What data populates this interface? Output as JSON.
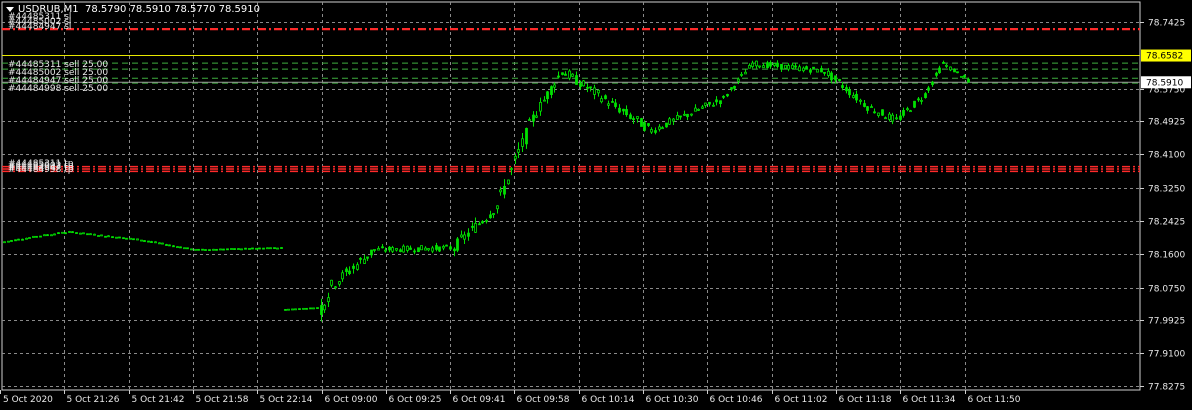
{
  "header": {
    "symbol": "USDRUB,M1",
    "ohlc": "78.5790 78.5910 78.5770 78.5910"
  },
  "colors": {
    "background": "#000000",
    "grid": "#8a8a8a",
    "candle": "#00e000",
    "text": "#ffffff",
    "sl_line": "#ff2a2a",
    "tp_line": "#d8b0b0",
    "order_line": "#3fae3f",
    "open_price_line": "#e8e800",
    "ask_label_bg": "#ffff00",
    "bid_label_bg": "#ffffff"
  },
  "price_axis": {
    "labels": [
      "78.7425",
      "78.6582",
      "78.5910",
      "78.4925",
      "78.4100",
      "78.3250",
      "78.2425",
      "78.1600",
      "78.0750",
      "77.9925",
      "77.9100",
      "77.8275"
    ],
    "ticks": [
      78.7425,
      78.575,
      78.4925,
      78.41,
      78.325,
      78.2425,
      78.16,
      78.075,
      77.9925,
      77.91,
      77.8275
    ],
    "tick_labels": [
      "78.7425",
      "78.5750",
      "78.4925",
      "78.4100",
      "78.3250",
      "78.2425",
      "78.1600",
      "78.0750",
      "77.9925",
      "77.9100",
      "77.8275"
    ],
    "ask_label": "78.6582",
    "ask_price": 78.6582,
    "bid_label": "78.5910",
    "bid_price": 78.591
  },
  "time_axis": {
    "labels": [
      "5 Oct 2020",
      "5 Oct 21:26",
      "5 Oct 21:42",
      "5 Oct 21:58",
      "5 Oct 22:14",
      "6 Oct 09:00",
      "6 Oct 09:25",
      "6 Oct 09:41",
      "6 Oct 09:58",
      "6 Oct 10:14",
      "6 Oct 10:30",
      "6 Oct 10:46",
      "6 Oct 11:02",
      "6 Oct 11:18",
      "6 Oct 11:34",
      "6 Oct 11:50"
    ]
  },
  "order_labels": {
    "top_sl": [
      "#44485311 sl",
      "#44485002 sl",
      "#44484947 sl"
    ],
    "sells": [
      "#44485311 sell 25.00",
      "#44485002 sell 25.00",
      "#44484947 sell 25.00",
      "#44484998 sell 25.00"
    ],
    "mid_tp": [
      "#44485311 tp",
      "#44485002 tp",
      "#44484947 tp",
      "#44484998 tp"
    ]
  },
  "order_levels": {
    "sl": [
      78.7235,
      78.7255
    ],
    "sells": [
      78.639,
      78.624,
      78.601,
      78.589
    ],
    "tp": [
      78.379,
      78.373,
      78.367
    ]
  },
  "chart_data": {
    "type": "candlestick",
    "title": "USDRUB,M1",
    "segments": [
      {
        "start": 78.19,
        "end": 78.205,
        "n": 10,
        "vol": 0.0035
      },
      {
        "start": 78.205,
        "end": 78.215,
        "n": 8,
        "vol": 0.004
      },
      {
        "start": 78.215,
        "end": 78.195,
        "n": 20,
        "vol": 0.0035
      },
      {
        "start": 78.195,
        "end": 78.17,
        "n": 15,
        "vol": 0.0035
      },
      {
        "start": 78.17,
        "end": 78.175,
        "n": 25,
        "vol": 0.0025
      },
      {
        "start": 78.02,
        "end": 78.025,
        "n": 10,
        "vol": 0.001
      },
      {
        "start": 78.025,
        "end": 78.08,
        "n": 3,
        "vol": 0.05
      },
      {
        "start": 78.08,
        "end": 78.17,
        "n": 12,
        "vol": 0.03
      },
      {
        "start": 78.17,
        "end": 78.175,
        "n": 22,
        "vol": 0.015
      },
      {
        "start": 78.175,
        "end": 78.28,
        "n": 12,
        "vol": 0.03
      },
      {
        "start": 78.28,
        "end": 78.5,
        "n": 10,
        "vol": 0.04
      },
      {
        "start": 78.5,
        "end": 78.62,
        "n": 8,
        "vol": 0.03
      },
      {
        "start": 78.62,
        "end": 78.47,
        "n": 25,
        "vol": 0.025
      },
      {
        "start": 78.47,
        "end": 78.55,
        "n": 20,
        "vol": 0.02
      },
      {
        "start": 78.55,
        "end": 78.638,
        "n": 8,
        "vol": 0.015
      },
      {
        "start": 78.638,
        "end": 78.62,
        "n": 20,
        "vol": 0.015
      },
      {
        "start": 78.62,
        "end": 78.53,
        "n": 12,
        "vol": 0.02
      },
      {
        "start": 78.53,
        "end": 78.495,
        "n": 8,
        "vol": 0.02
      },
      {
        "start": 78.495,
        "end": 78.56,
        "n": 8,
        "vol": 0.02
      },
      {
        "start": 78.56,
        "end": 78.638,
        "n": 5,
        "vol": 0.015
      },
      {
        "start": 78.638,
        "end": 78.591,
        "n": 8,
        "vol": 0.01
      }
    ],
    "ylim": [
      77.8275,
      78.7425
    ],
    "last_close": 78.591
  }
}
